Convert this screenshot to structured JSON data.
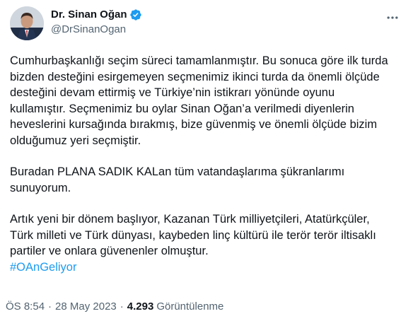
{
  "author": {
    "display_name": "Dr. Sinan Oğan",
    "handle": "@DrSinanOgan"
  },
  "tweet": {
    "paragraph_1": "Cumhurbaşkanlığı seçim süreci tamamlanmıştır. Bu sonuca göre ilk turda\nbizden desteğini esirgemeyen seçmenimiz ikinci turda da önemli ölçüde\ndesteğini devam ettirmiş ve Türkiye’nin istikrarı yönünde oyunu\nkullamıştır. Seçmenimiz bu oylar Sinan Oğan’a verilmedi diyenlerin\nheveslerini kursağında bırakmış, bize güvenmiş ve önemli ölçüde bizim\nolduğumuz yeri seçmiştir.",
    "paragraph_2": "Buradan PLANA SADIK KALan tüm vatandaşlarıma şükranlarımı\nsunuyorum.",
    "paragraph_3": "Artık yeni bir dönem başlıyor, Kazanan Türk milliyetçileri, Atatürkçüler,\nTürk milleti ve Türk dünyası, kaybeden linç kültürü ile terör terör iltisaklı\npartiler ve onlara güvenenler olmuştur.",
    "hashtag": "#OAnGeliyor"
  },
  "meta": {
    "time": "ÖS 8:54",
    "separator": "·",
    "date": "28 May 2023",
    "views_count": "4.293",
    "views_label": "Görüntülenme"
  },
  "colors": {
    "text": "#0f1419",
    "secondary": "#536471",
    "accent": "#1d9bf0"
  },
  "icons": {
    "verified": "verified-badge-icon",
    "more": "more-options-icon"
  }
}
